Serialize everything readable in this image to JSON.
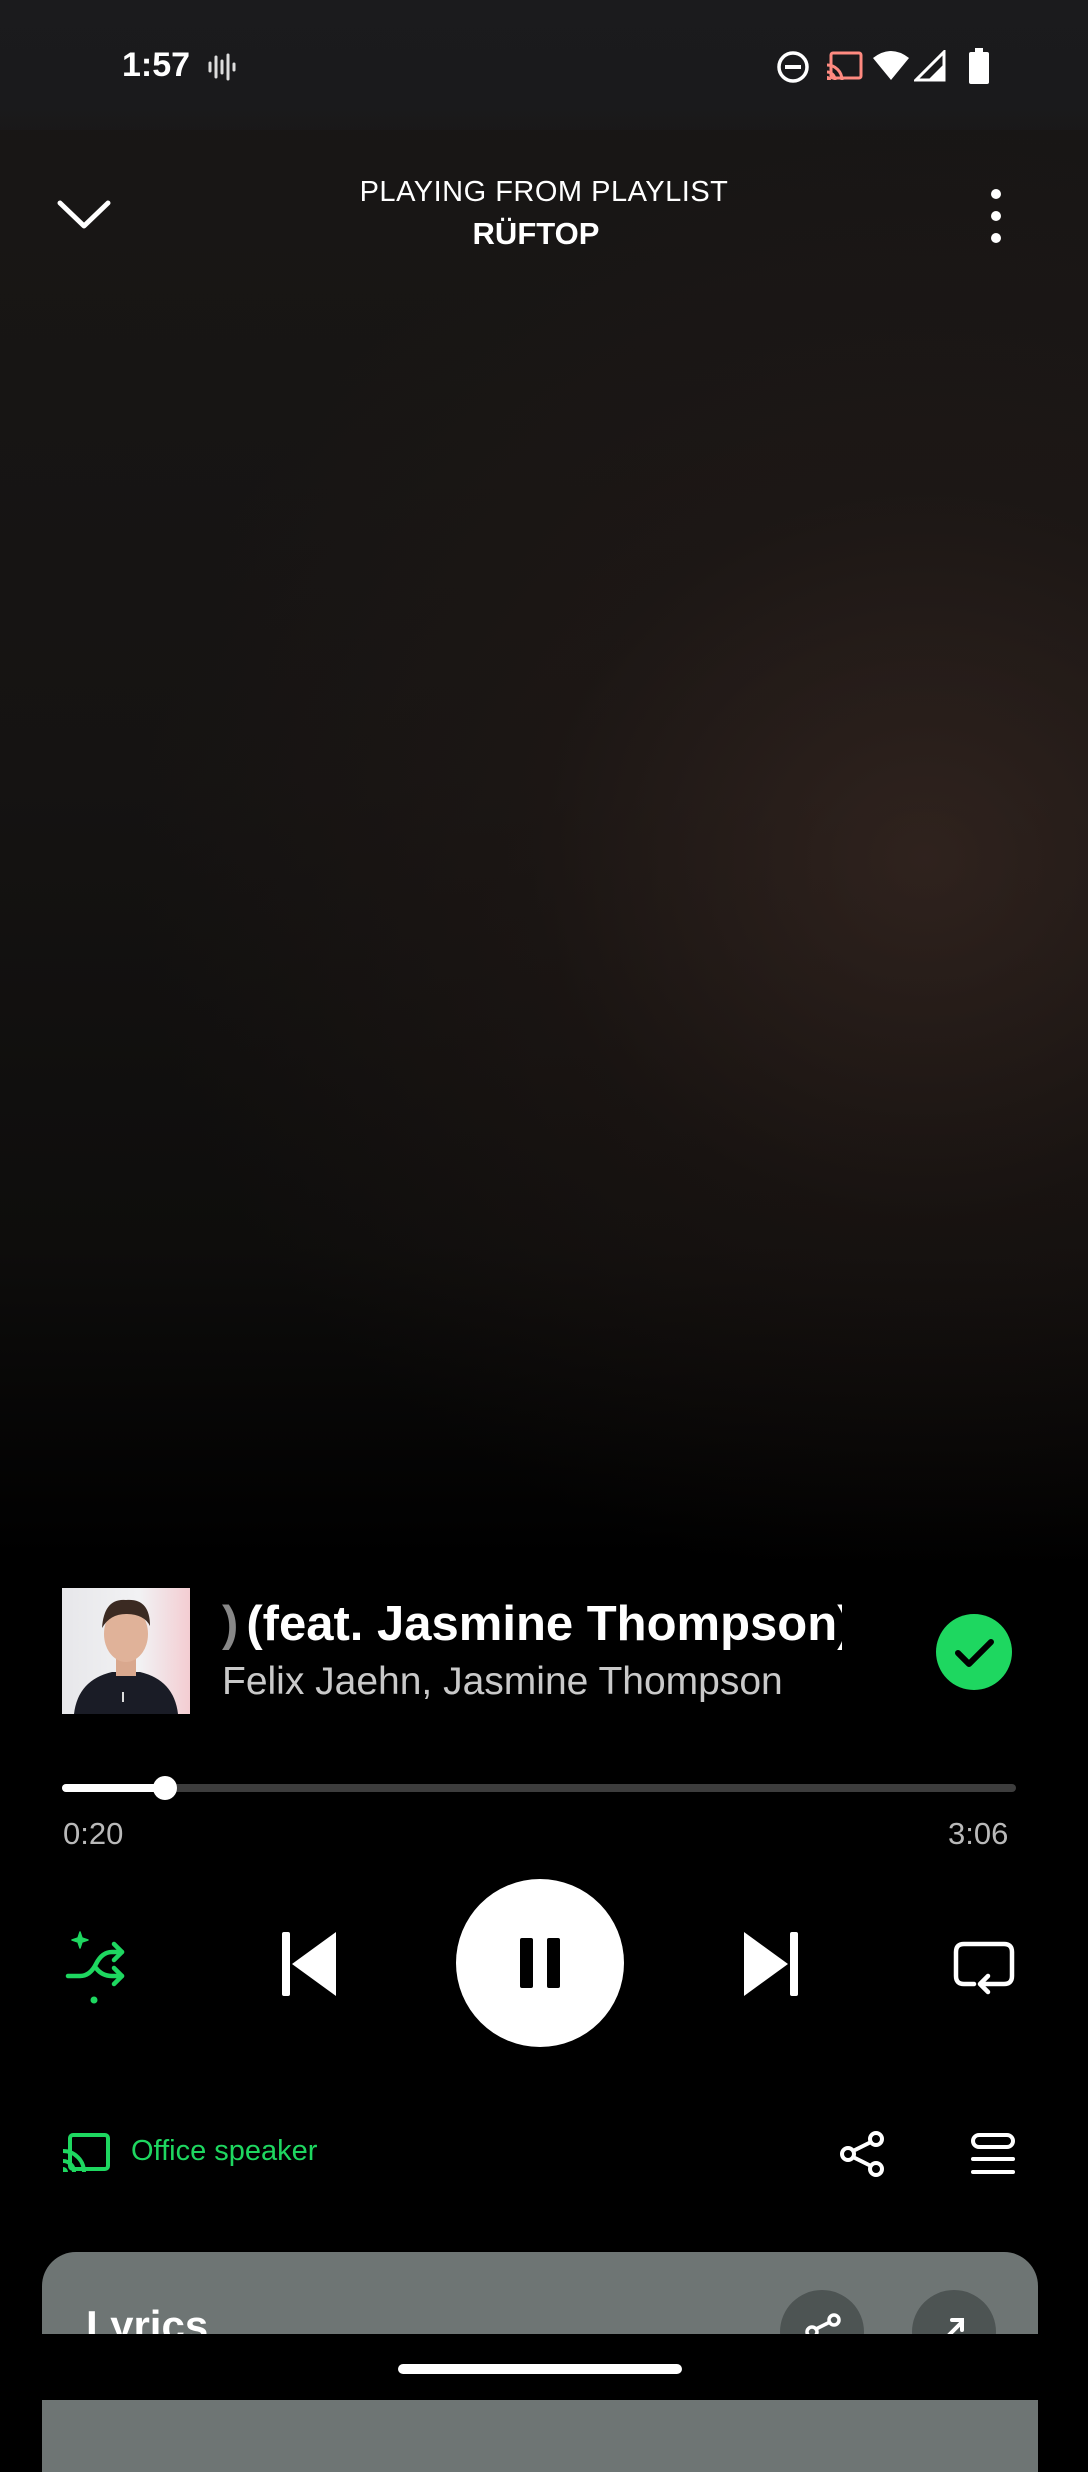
{
  "status_bar": {
    "time": "1:57",
    "icons": [
      "sound-wave-icon",
      "do-not-disturb-icon",
      "cast-icon",
      "wifi-icon",
      "cell-signal-icon",
      "battery-icon"
    ]
  },
  "header": {
    "context": "PLAYING FROM PLAYLIST",
    "playlist": "RÜFTOP"
  },
  "track": {
    "title_fragment": ")",
    "title": "(feat. Jasmine Thompson)",
    "artists": "Felix Jaehn, Jasmine Thompson",
    "liked": true
  },
  "playback": {
    "elapsed": "0:20",
    "duration": "3:06",
    "progress": 0.1075,
    "shuffle": "on",
    "repeat": "off",
    "state": "playing"
  },
  "device": {
    "name": "Office speaker"
  },
  "lyrics": {
    "title": "Lyrics"
  },
  "colors": {
    "accent": "#1ed760",
    "background": "#000000",
    "card": "#6e7574",
    "muted_text": "#b9b9b9"
  }
}
